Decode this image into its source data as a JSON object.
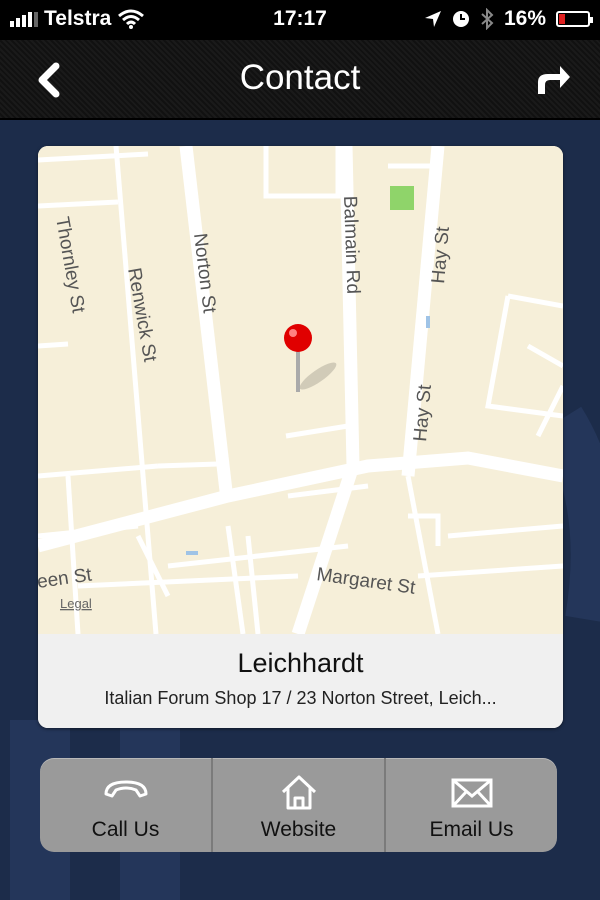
{
  "status_bar": {
    "carrier": "Telstra",
    "time": "17:17",
    "battery": "16%"
  },
  "nav": {
    "title": "Contact"
  },
  "map": {
    "streets": [
      "Thornley St",
      "Renwick St",
      "Norton St",
      "Balmain Rd",
      "Hay St",
      "Hay St",
      "een St",
      "Margaret St"
    ],
    "legal": "Legal"
  },
  "location": {
    "name": "Leichhardt",
    "address": "Italian Forum Shop 17 / 23 Norton Street, Leich..."
  },
  "actions": [
    {
      "label": "Call Us",
      "icon": "phone-icon"
    },
    {
      "label": "Website",
      "icon": "home-icon"
    },
    {
      "label": "Email Us",
      "icon": "envelope-icon"
    }
  ],
  "colors": {
    "background": "#1c2c4a",
    "map": "#f6efd9",
    "pin": "#e00000",
    "battery_low": "#e02020"
  }
}
